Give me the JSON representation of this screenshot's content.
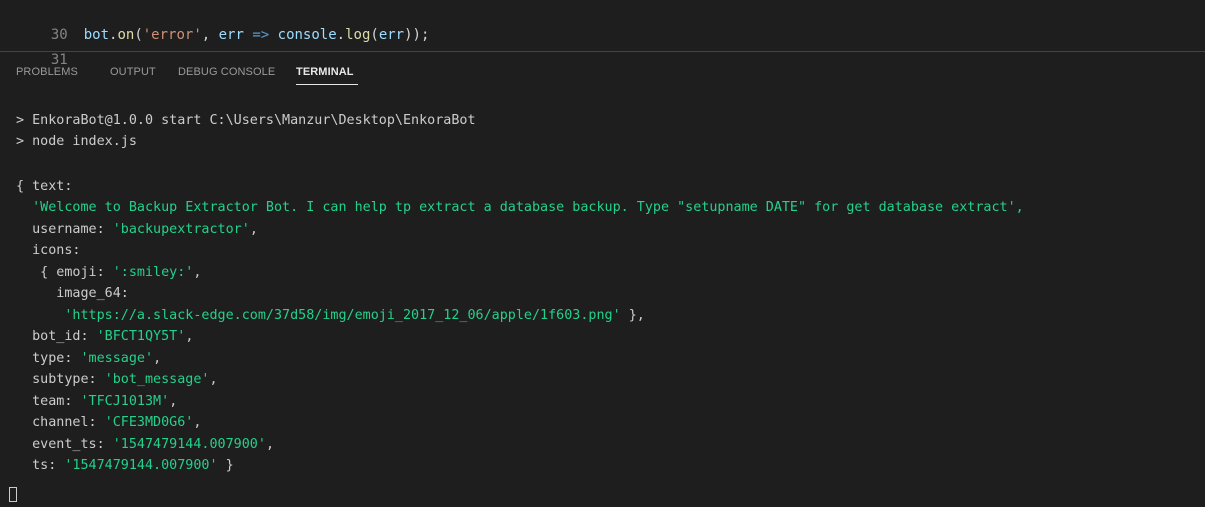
{
  "editor": {
    "lines": [
      {
        "number": "30",
        "parts": [
          "bot",
          ".",
          "on",
          "(",
          "'error'",
          ", ",
          "err",
          " => ",
          "console",
          ".",
          "log",
          "(",
          "err",
          "));"
        ]
      },
      {
        "number": "31"
      }
    ]
  },
  "panel": {
    "tabs": [
      {
        "label": "PROBLEMS"
      },
      {
        "label": "OUTPUT"
      },
      {
        "label": "DEBUG CONSOLE"
      },
      {
        "label": "TERMINAL",
        "active": true
      }
    ]
  },
  "terminal": {
    "line1": "> EnkoraBot@1.0.0 start C:\\Users\\Manzur\\Desktop\\EnkoraBot",
    "line2": "> node index.js",
    "line3": "{ text:",
    "line4": "  'Welcome to Backup Extractor Bot. I can help tp extract a database backup. Type \"setupname DATE\" for get database extract',",
    "username_key": "  username: ",
    "username_val": "'backupextractor'",
    "username_end": ",",
    "icons_key": "  icons:",
    "emoji_key": "   { emoji: ",
    "emoji_val": "':smiley:'",
    "emoji_end": ",",
    "image_key": "     image_64:",
    "image_val": "      'https://a.slack-edge.com/37d58/img/emoji_2017_12_06/apple/1f603.png'",
    "image_end": " },",
    "bot_id_key": "  bot_id: ",
    "bot_id_val": "'BFCT1QY5T'",
    "bot_id_end": ",",
    "type_key": "  type: ",
    "type_val": "'message'",
    "type_end": ",",
    "subtype_key": "  subtype: ",
    "subtype_val": "'bot_message'",
    "subtype_end": ",",
    "team_key": "  team: ",
    "team_val": "'TFCJ1013M'",
    "team_end": ",",
    "channel_key": "  channel: ",
    "channel_val": "'CFE3MD0G6'",
    "channel_end": ",",
    "event_ts_key": "  event_ts: ",
    "event_ts_val": "'1547479144.007900'",
    "event_ts_end": ",",
    "ts_key": "  ts: ",
    "ts_val": "'1547479144.007900'",
    "ts_end": " }"
  },
  "colors": {
    "background": "#1e1e1e",
    "string_green": "#23d18b",
    "terminal_text": "#cccccc"
  }
}
